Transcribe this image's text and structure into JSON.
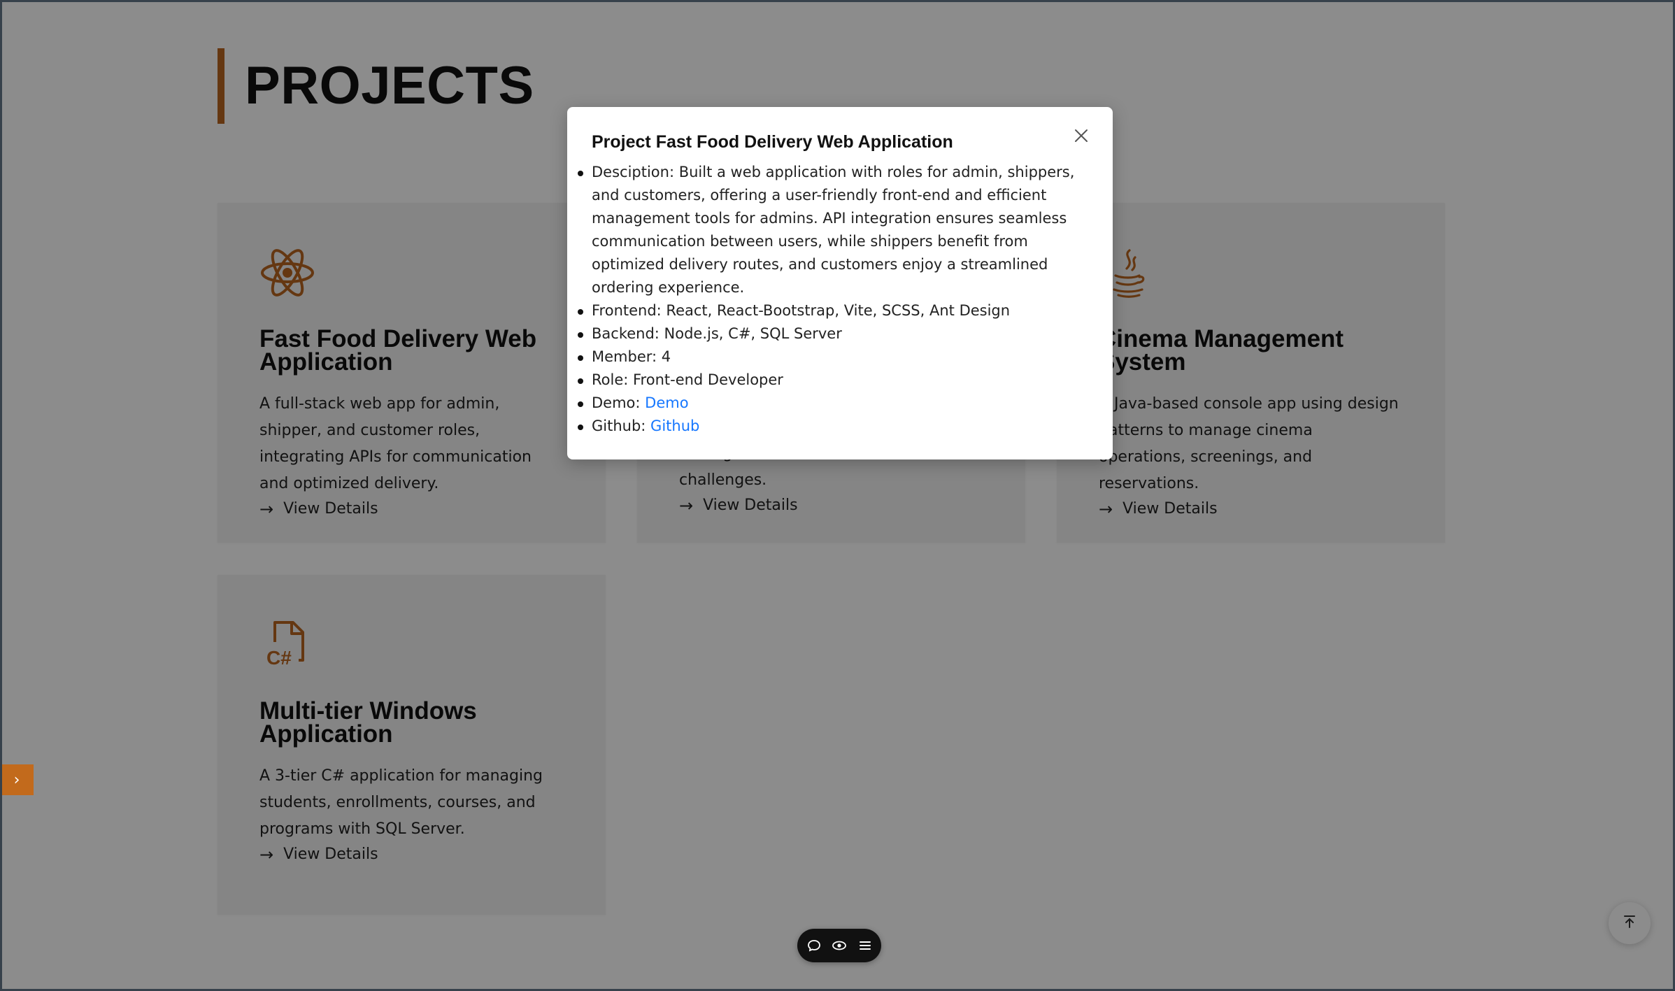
{
  "section": {
    "title": "PROJECTS"
  },
  "cards": [
    {
      "icon": "react-icon",
      "title": "Fast Food Delivery Web Application",
      "description": "A full-stack web app for admin, shipper, and customer roles, integrating APIs for communication and optimized delivery.",
      "link_label": "View Details"
    },
    {
      "icon": "",
      "title": "",
      "description": "management and interactive challenges.",
      "link_label": "View Details"
    },
    {
      "icon": "java-icon",
      "title": "Cinema Management System",
      "description": "A Java-based console app using design patterns to manage cinema operations, screenings, and reservations.",
      "link_label": "View Details"
    },
    {
      "icon": "csharp-file-icon",
      "title": "Multi-tier Windows Application",
      "description": "A 3-tier C# application for managing students, enrollments, courses, and programs with SQL Server.",
      "link_label": "View Details"
    }
  ],
  "modal": {
    "title": "Project Fast Food Delivery Web Application",
    "description": "Desciption: Built a web application with roles for admin, shippers, and customers, offering a user-friendly front-end and efficient management tools for admins. API integration ensures seamless communication between users, while shippers benefit from optimized delivery routes, and customers enjoy a streamlined ordering experience.",
    "frontend": "Frontend: React, React-Bootstrap, Vite, SCSS, Ant Design",
    "backend": "Backend: Node.js, C#, SQL Server",
    "member": "Member: 4",
    "role": "Role: Front-end Developer",
    "demo_label": "Demo: ",
    "demo_link": "Demo",
    "github_label": "Github: ",
    "github_link": "Github"
  },
  "toolbar": {
    "icons": [
      "comment-icon",
      "eye-icon",
      "menu-icon"
    ]
  },
  "colors": {
    "accent": "#b8651f",
    "card_bg": "#f2f2f2",
    "link": "#1677ff"
  }
}
